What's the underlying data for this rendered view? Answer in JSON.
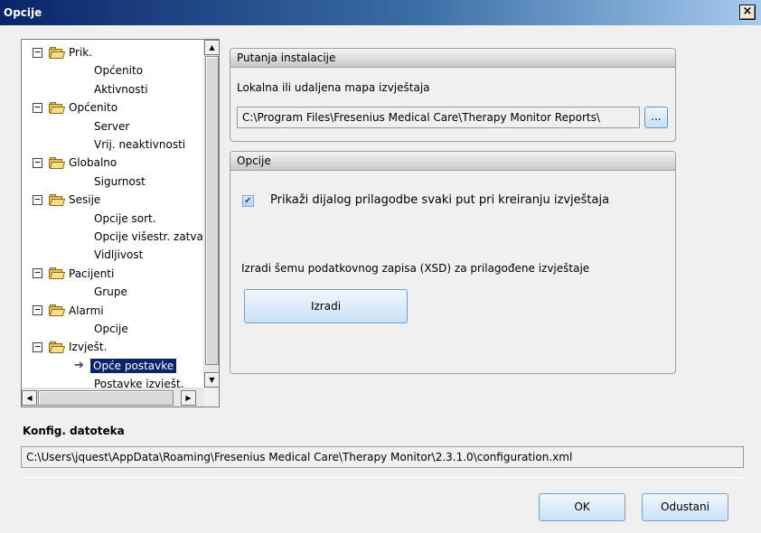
{
  "window": {
    "title": "Opcije",
    "close_glyph": "×"
  },
  "tree": {
    "items": [
      {
        "label": "Prik.",
        "kind": "folder"
      },
      {
        "label": "Općenito",
        "kind": "leaf"
      },
      {
        "label": "Aktivnosti",
        "kind": "leaf"
      },
      {
        "label": "Općenito",
        "kind": "folder"
      },
      {
        "label": "Server",
        "kind": "leaf"
      },
      {
        "label": "Vrij. neaktivnosti",
        "kind": "leaf"
      },
      {
        "label": "Globalno",
        "kind": "folder"
      },
      {
        "label": "Sigurnost",
        "kind": "leaf"
      },
      {
        "label": "Sesije",
        "kind": "folder"
      },
      {
        "label": "Opcije sort.",
        "kind": "leaf"
      },
      {
        "label": "Opcije višestr. zatva",
        "kind": "leaf"
      },
      {
        "label": "Vidljivost",
        "kind": "leaf"
      },
      {
        "label": "Pacijenti",
        "kind": "folder"
      },
      {
        "label": "Grupe",
        "kind": "leaf"
      },
      {
        "label": "Alarmi",
        "kind": "folder"
      },
      {
        "label": "Opcije",
        "kind": "leaf"
      },
      {
        "label": "Izvješt.",
        "kind": "folder"
      },
      {
        "label": "Opće postavke",
        "kind": "leaf",
        "selected": true
      },
      {
        "label": "Postavke izvješt.",
        "kind": "leaf"
      }
    ],
    "expander_glyph": "−",
    "selected_marker": "➔"
  },
  "install_path": {
    "header": "Putanja instalacije",
    "label": "Lokalna ili udaljena mapa izvještaja",
    "value": "C:\\Program Files\\Fresenius Medical Care\\Therapy Monitor Reports\\",
    "browse_label": "..."
  },
  "options": {
    "header": "Opcije",
    "checkbox_label": "Prikaži dijalog prilagodbe svaki put pri kreiranju izvještaja",
    "checkbox_checked": true,
    "xsd_label": "Izradi šemu podatkovnog zapisa (XSD) za prilagođene izvještaje",
    "create_button": "Izradi"
  },
  "config": {
    "label": "Konfig. datoteka",
    "path": "C:\\Users\\jquest\\AppData\\Roaming\\Fresenius Medical Care\\Therapy Monitor\\2.3.1.0\\configuration.xml"
  },
  "footer": {
    "ok": "OK",
    "cancel": "Odustani"
  },
  "colors": {
    "selection": "#0a246a",
    "titlebar": "#0a246a"
  }
}
